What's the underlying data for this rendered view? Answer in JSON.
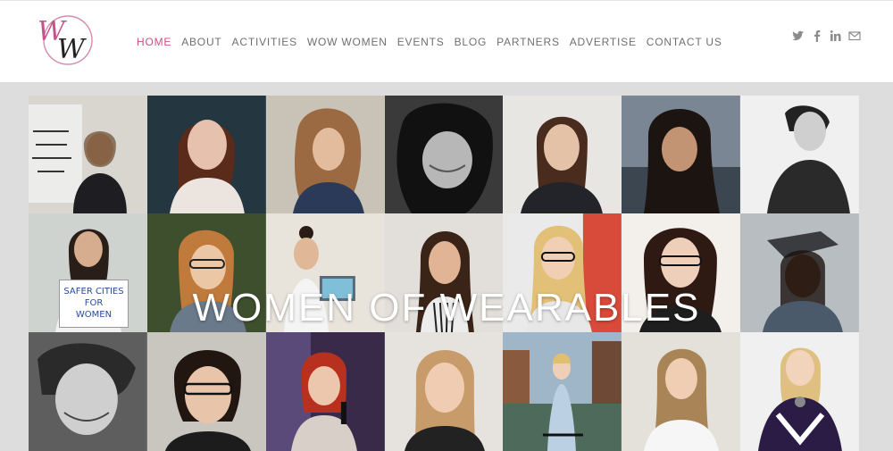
{
  "header": {
    "logo_alt": "WW",
    "nav": [
      {
        "label": "HOME",
        "active": true
      },
      {
        "label": "ABOUT"
      },
      {
        "label": "ACTIVITIES"
      },
      {
        "label": "WOW WOMEN"
      },
      {
        "label": "EVENTS"
      },
      {
        "label": "BLOG"
      },
      {
        "label": "PARTNERS"
      },
      {
        "label": "ADVERTISE"
      },
      {
        "label": "CONTACT US"
      }
    ],
    "social_icons": [
      "twitter-icon",
      "facebook-icon",
      "linkedin-icon",
      "email-icon"
    ]
  },
  "hero": {
    "title": "WOMEN OF WEARABLES",
    "sign_text": "SAFER CITIES FOR WOMEN"
  },
  "colors": {
    "accent": "#c8508b",
    "nav_text": "#6f6f6f",
    "page_bg": "#dddddd"
  }
}
